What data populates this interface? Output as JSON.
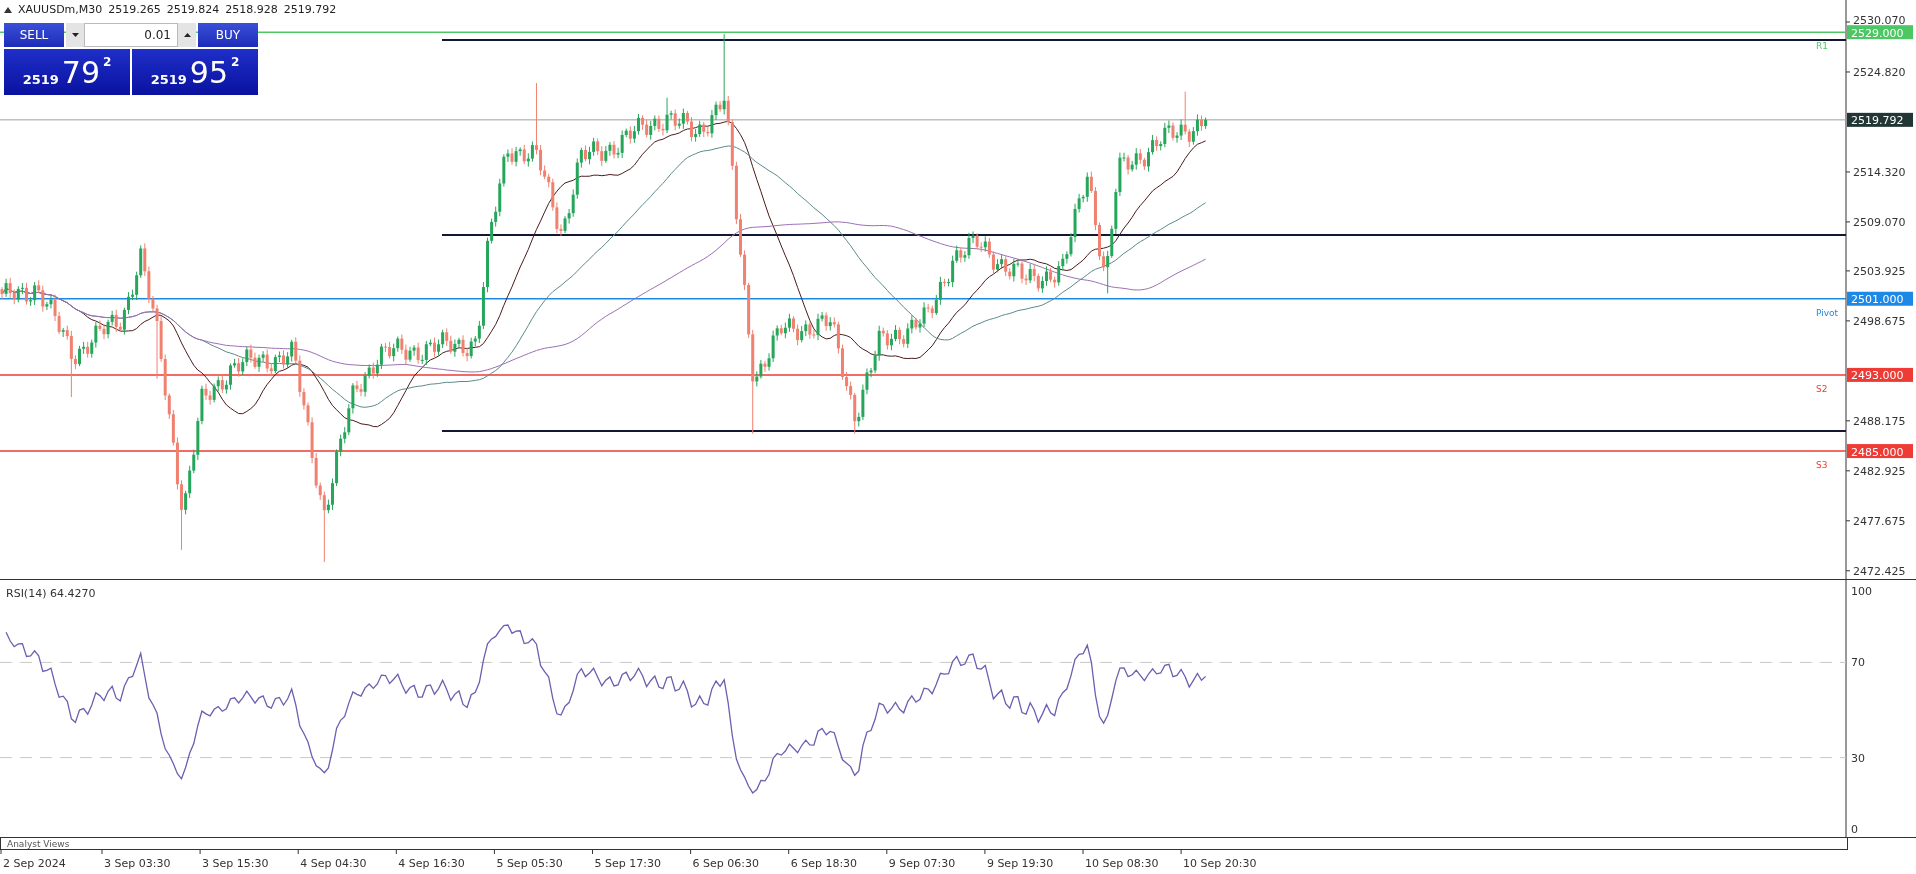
{
  "chart_header": {
    "symbol": "XAUUSDm,M30",
    "ohlc": [
      "2519.265",
      "2519.824",
      "2518.928",
      "2519.792"
    ]
  },
  "trade_panel": {
    "sell": {
      "label": "SELL",
      "price_prefix": "2519",
      "price_pips": "79",
      "price_point": "2"
    },
    "volume": "0.01",
    "buy": {
      "label": "BUY",
      "price_prefix": "2519",
      "price_pips": "95",
      "price_point": "2"
    }
  },
  "price_axis": {
    "ticks": [
      "2530.070",
      "2524.820",
      "2514.320",
      "2509.070",
      "2503.925",
      "2498.675",
      "2488.175",
      "2482.925",
      "2477.675",
      "2472.425"
    ],
    "current_price": "2519.792"
  },
  "levels": [
    {
      "price": "2529.000",
      "tag": "R1",
      "color": "#4cc764"
    },
    {
      "price": "2501.000",
      "tag": "Pivot",
      "color": "#1e88e5"
    },
    {
      "price": "2493.000",
      "tag": "S2",
      "color": "#ee3b35"
    },
    {
      "price": "2485.000",
      "tag": "S3",
      "color": "#ee3b35"
    }
  ],
  "rsi_pane": {
    "label": "RSI(14) 64.4270",
    "ticks": [
      "100",
      "70",
      "30",
      "0"
    ]
  },
  "analyst_panel": {
    "title": "Analyst Views"
  },
  "time_axis": {
    "labels": [
      "2 Sep 2024",
      "3 Sep 03:30",
      "3 Sep 15:30",
      "4 Sep 04:30",
      "4 Sep 16:30",
      "5 Sep 05:30",
      "5 Sep 17:30",
      "6 Sep 06:30",
      "6 Sep 18:30",
      "9 Sep 07:30",
      "9 Sep 19:30",
      "10 Sep 08:30",
      "10 Sep 20:30"
    ]
  }
}
